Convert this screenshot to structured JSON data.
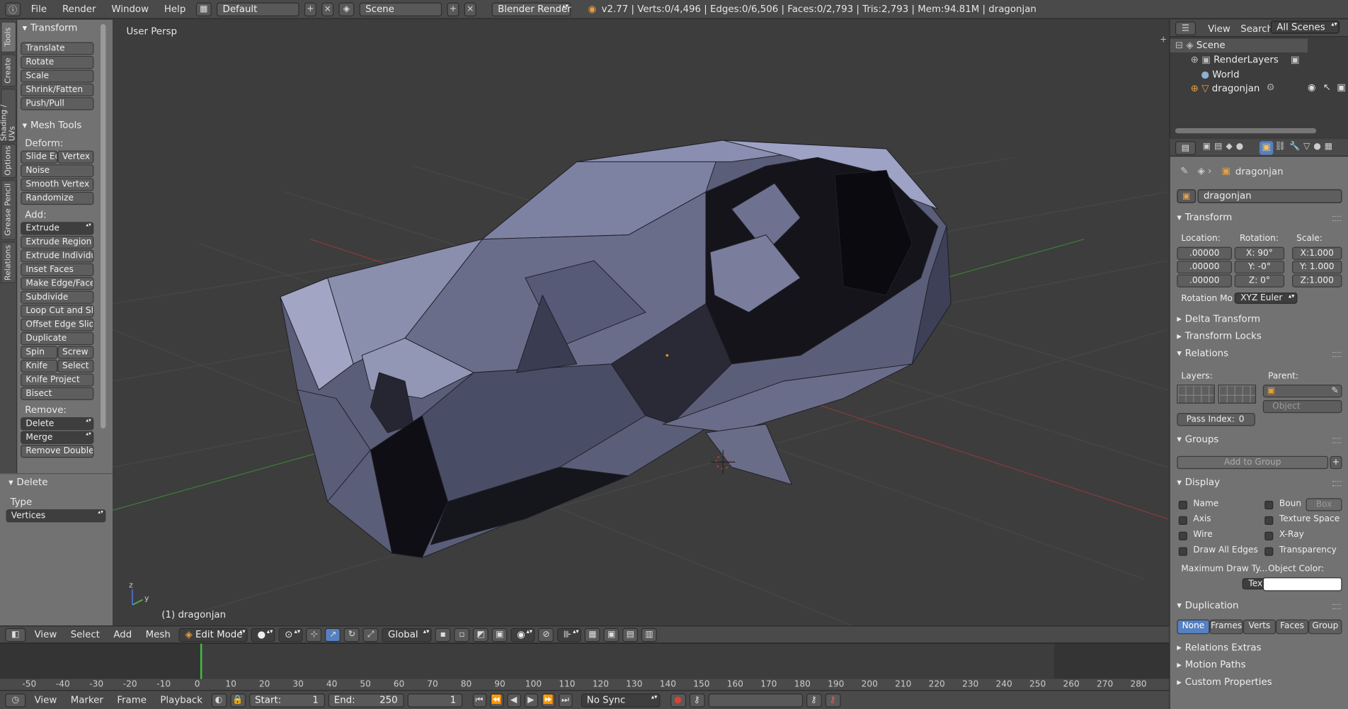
{
  "topbar": {
    "menus": [
      "File",
      "Render",
      "Window",
      "Help"
    ],
    "layout": "Default",
    "scene": "Scene",
    "engine": "Blender Render",
    "stats": "v2.77 | Verts:0/4,496 | Edges:0/6,506 | Faces:0/2,793 | Tris:2,793 | Mem:94.81M | dragonjan"
  },
  "tabs": [
    "Tools",
    "Create",
    "Shading / UVs",
    "Options",
    "Grease Pencil",
    "Relations"
  ],
  "tools": {
    "transform_header": "Transform",
    "transform": [
      "Translate",
      "Rotate",
      "Scale",
      "Shrink/Fatten",
      "Push/Pull"
    ],
    "mesh_header": "Mesh Tools",
    "deform_label": "Deform:",
    "slide_edge": "Slide Ed",
    "vertex": "Vertex",
    "deform": [
      "Noise",
      "Smooth Vertex",
      "Randomize"
    ],
    "add_label": "Add:",
    "extrude": "Extrude",
    "add": [
      "Extrude Region",
      "Extrude Individual",
      "Inset Faces",
      "Make Edge/Face",
      "Subdivide",
      "Loop Cut and Slide",
      "Offset Edge Slide",
      "Duplicate"
    ],
    "spin": "Spin",
    "screw": "Screw",
    "knife": "Knife",
    "select": "Select",
    "add2": [
      "Knife Project",
      "Bisect"
    ],
    "remove_label": "Remove:",
    "delete": "Delete",
    "merge": "Merge",
    "remove_doubles": "Remove Doubles"
  },
  "delete_panel": {
    "header": "Delete",
    "type_label": "Type",
    "type_value": "Vertices"
  },
  "viewport": {
    "persp": "User Persp",
    "object": "(1) dragonjan",
    "axis_y": "y",
    "axis_z": "z"
  },
  "outliner": {
    "menus": [
      "View",
      "Search"
    ],
    "filter": "All Scenes",
    "items": [
      "Scene",
      "RenderLayers",
      "World",
      "dragonjan"
    ]
  },
  "props": {
    "object_name": "dragonjan",
    "breadcrumb": "dragonjan",
    "transform": "Transform",
    "location_label": "Location:",
    "rotation_label": "Rotation:",
    "scale_label": "Scale:",
    "location": [
      ".00000",
      ".00000",
      ".00000"
    ],
    "rotation": [
      "X:  90°",
      "Y:   -0°",
      "Z:    0°"
    ],
    "scale": [
      "X:1.000",
      "Y: 1.000",
      "Z:1.000"
    ],
    "rotation_mode_label": "Rotation Mo",
    "rotation_mode": "XYZ Euler",
    "delta": "Delta Transform",
    "locks": "Transform Locks",
    "relations": "Relations",
    "layers_label": "Layers:",
    "parent_label": "Parent:",
    "parent_type": "Object",
    "pass_index_label": "Pass Index:",
    "pass_index": "0",
    "groups": "Groups",
    "add_to_group": "Add to Group",
    "display": "Display",
    "checks_left": [
      "Name",
      "Axis",
      "Wire",
      "Draw All Edges"
    ],
    "checks_right": [
      "Boun",
      "Texture Space",
      "X-Ray",
      "Transparency"
    ],
    "bounds_type": "Box",
    "max_draw_label": "Maximum Draw Ty...",
    "max_draw": "Textured",
    "object_color_label": "Object Color:",
    "duplication": "Duplication",
    "dup_options": [
      "None",
      "Frames",
      "Verts",
      "Faces",
      "Group"
    ],
    "relations_extras": "Relations Extras",
    "motion_paths": "Motion Paths",
    "custom_props": "Custom Properties"
  },
  "view_header": {
    "menus": [
      "View",
      "Select",
      "Add",
      "Mesh"
    ],
    "mode": "Edit Mode",
    "orientation": "Global"
  },
  "timeline": {
    "ticks": [
      "-50",
      "-40",
      "-30",
      "-20",
      "-10",
      "0",
      "10",
      "20",
      "30",
      "40",
      "50",
      "60",
      "70",
      "80",
      "90",
      "100",
      "110",
      "120",
      "130",
      "140",
      "150",
      "160",
      "170",
      "180",
      "190",
      "200",
      "210",
      "220",
      "230",
      "240",
      "250",
      "260",
      "270",
      "280"
    ],
    "current_frame_value": 1
  },
  "tl_header": {
    "menus": [
      "View",
      "Marker",
      "Frame",
      "Playback"
    ],
    "start_label": "Start:",
    "start": "1",
    "end_label": "End:",
    "end": "250",
    "current": "1",
    "sync": "No Sync"
  }
}
